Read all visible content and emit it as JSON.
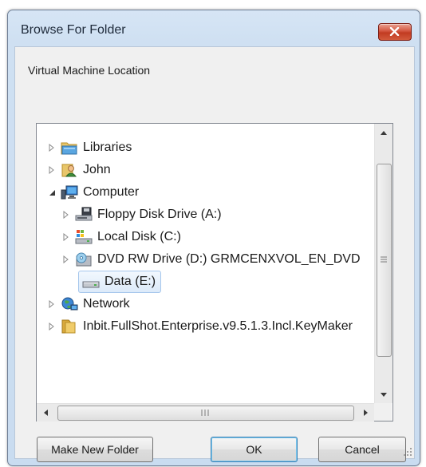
{
  "window": {
    "title": "Browse For Folder"
  },
  "description": "Virtual Machine Location",
  "tree": {
    "items": [
      {
        "label": "Libraries",
        "icon": "libraries-icon"
      },
      {
        "label": "John",
        "icon": "user-folder-icon"
      },
      {
        "label": "Computer",
        "icon": "computer-icon"
      },
      {
        "label": "Floppy Disk Drive (A:)",
        "icon": "floppy-drive-icon"
      },
      {
        "label": "Local Disk (C:)",
        "icon": "local-disk-icon"
      },
      {
        "label": "DVD RW Drive (D:) GRMCENXVOL_EN_DVD",
        "icon": "dvd-drive-icon"
      },
      {
        "label": "Data (E:)",
        "icon": "hard-drive-icon",
        "selected": true
      },
      {
        "label": "Network",
        "icon": "network-icon"
      },
      {
        "label": "Inbit.FullShot.Enterprise.v9.5.1.3.Incl.KeyMaker",
        "icon": "folder-icon"
      }
    ]
  },
  "scrollbar": {
    "horizontal_grip": "III",
    "vertical_grip": "≡"
  },
  "buttons": {
    "make_new_folder": "Make New Folder",
    "ok": "OK",
    "cancel": "Cancel"
  },
  "colors": {
    "title_gradient": "#cfe0f2",
    "close_red": "#c23b22",
    "selection": "#dceaf9",
    "default_button_border": "#3c7fb1"
  }
}
